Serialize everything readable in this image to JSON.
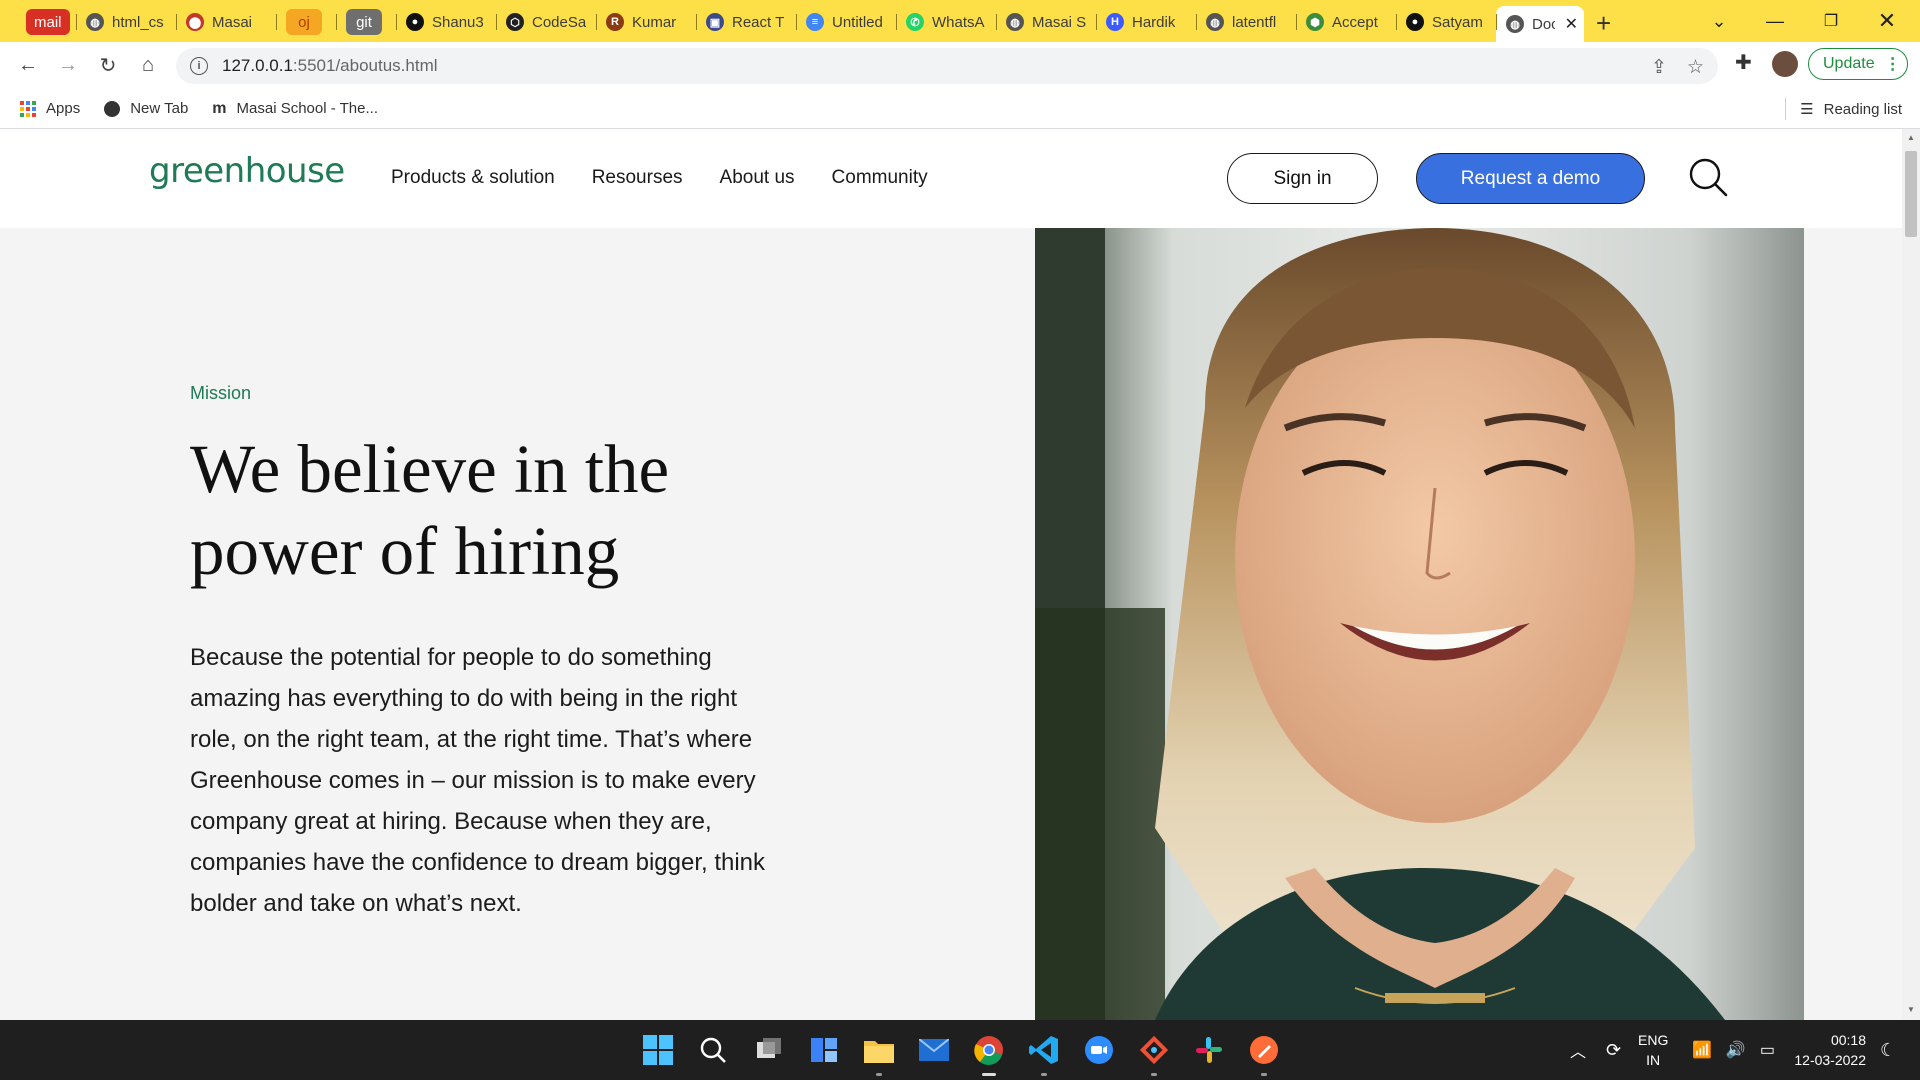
{
  "browser": {
    "tabs": [
      {
        "label": "mail",
        "pinned": true,
        "color": "#d93025",
        "text_color": "#ffffff"
      },
      {
        "label": "html_cs",
        "icon": "globe-icon"
      },
      {
        "label": "Masai",
        "icon": "location-pin-icon"
      },
      {
        "label": "oj",
        "pinned": true,
        "color": "#f5a623",
        "text_color": "#ad3e00"
      },
      {
        "label": "git",
        "pinned": true,
        "color": "#6f6f6f",
        "text_color": "#ffffff"
      },
      {
        "label": "Shanu3",
        "icon": "github-icon"
      },
      {
        "label": "CodeSa",
        "icon": "codesandbox-icon"
      },
      {
        "label": "Kumar",
        "icon": "r-logo-icon"
      },
      {
        "label": "React T",
        "icon": "save-icon"
      },
      {
        "label": "Untitled",
        "icon": "google-docs-icon"
      },
      {
        "label": "WhatsA",
        "icon": "whatsapp-icon"
      },
      {
        "label": "Masai S",
        "icon": "globe-icon"
      },
      {
        "label": "Hardik",
        "icon": "h-logo-icon"
      },
      {
        "label": "latentfl",
        "icon": "globe-icon"
      },
      {
        "label": "Accept",
        "icon": "hexagon-icon"
      },
      {
        "label": "Satyam",
        "icon": "github-icon"
      },
      {
        "label": "Doc",
        "icon": "globe-icon",
        "active": true
      }
    ],
    "new_tab": "+",
    "url_host": "127.0.0.1",
    "url_path": ":5501/aboutus.html",
    "update_label": "Update",
    "bookmarks": [
      {
        "label": "Apps",
        "icon": "apps-grid-icon"
      },
      {
        "label": "New Tab",
        "icon": "globe-icon"
      },
      {
        "label": "Masai School - The...",
        "icon": "masai-m-icon"
      }
    ],
    "reading_list": "Reading list",
    "tabbar_color": "#fde047"
  },
  "site": {
    "logo": "greenhouse",
    "nav": [
      "Products & solution",
      "Resourses",
      "About us",
      "Community"
    ],
    "sign_in": "Sign in",
    "request_demo": "Request a demo",
    "brand_green": "#1f7a58",
    "demo_blue": "#3870e0"
  },
  "hero": {
    "label": "Mission",
    "headline_line1": "We believe in the",
    "headline_line2": "power of hiring",
    "body": "Because the potential for people to do something amazing has everything to do with being in the right role, on the right team, at the right time. That’s where Greenhouse comes in – our mission is to make every company great at hiring. Because when they are, companies have the confidence to dream bigger, think bolder and take on what’s next."
  },
  "taskbar": {
    "icons": [
      "windows-start-icon",
      "search-icon",
      "task-view-icon",
      "widgets-icon",
      "file-explorer-icon",
      "mail-icon",
      "chrome-icon",
      "vscode-icon",
      "zoom-icon",
      "git-icon",
      "slack-icon",
      "postman-icon"
    ],
    "lang_line1": "ENG",
    "lang_line2": "IN",
    "time": "00:18",
    "date": "12-03-2022"
  }
}
